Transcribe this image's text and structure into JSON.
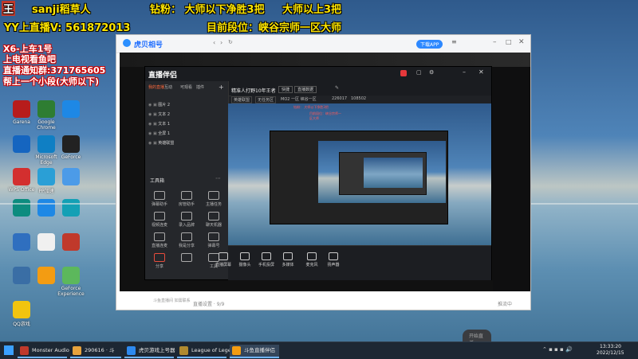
{
  "overlay": {
    "top_name": "sanji稻草人",
    "top_rank1": "钻粉： 大师以下净胜3把",
    "top_rank2": "大师以上3把",
    "yy_line": "YY上直播V:  561872013",
    "current_rank": "目前段位：峡谷宗师一区大师",
    "promo1": "X6-上车1号",
    "promo2": "上电视看鱼吧",
    "promo3": "直播通知群:371765605",
    "promo4": "帮上一个小段(大师以下)"
  },
  "desktop_icons": [
    {
      "label": "Garena",
      "color": "#b71c1c"
    },
    {
      "label": "Google Chrome",
      "color": "#2e7d32"
    },
    {
      "label": "",
      "color": "#1e88e5"
    },
    {
      "label": "",
      "color": "#1565c0"
    },
    {
      "label": "Microsoft Edge",
      "color": "#0f7fc4"
    },
    {
      "label": "GeForce",
      "color": "#222222"
    },
    {
      "label": "WPS Office",
      "color": "#d32f2f"
    },
    {
      "label": "PP加速",
      "color": "#2a9fd6"
    },
    {
      "label": "",
      "color": "#4c9be8"
    },
    {
      "label": "",
      "color": "#0d8c7f"
    },
    {
      "label": "",
      "color": "#1e88e5"
    },
    {
      "label": "",
      "color": "#14a0b5"
    },
    {
      "label": "",
      "color": "#2f6fbf"
    },
    {
      "label": "",
      "color": "#f0f0f0"
    },
    {
      "label": "",
      "color": "#c0392b"
    },
    {
      "label": "",
      "color": "#3a6ea5"
    },
    {
      "label": "",
      "color": "#f39c12"
    },
    {
      "label": "GeForce Experience",
      "color": "#5cb85c"
    },
    {
      "label": "QQ游戏",
      "color": "#f1c40f"
    }
  ],
  "app": {
    "logo": "虎贝相号",
    "download_btn": "下载APP",
    "tabs": [
      "我的直播",
      "互动",
      "可观看",
      "插件"
    ],
    "layers": [
      "图片 2",
      "文本 2",
      "文本 1",
      "全屏 1",
      "英雄联盟"
    ],
    "room_title": "精准人打野10年王者",
    "room_tag": "快捷",
    "room_status": "直播数据",
    "room_category": "英雄联盟",
    "room_sub": "无任务区",
    "room_id": "MO2  一区 峡谷一区",
    "room_fans": "226017",
    "room_follow": "108502",
    "brand": "直播伴侣",
    "tools_title": "工具箱",
    "tools": [
      "弹幕助手",
      "房管助手",
      "主播任务",
      "视频连麦",
      "录入品牌",
      "聊天机器",
      "直播连麦",
      "我是分享",
      "弹幕号",
      "分享",
      "",
      "工具"
    ],
    "bottom_btns": [
      "直播屏幕",
      "摄像头",
      "手机投屏",
      "多媒体",
      "麦克风",
      "扬声器"
    ],
    "start_btn": "开始直播",
    "notice": "斗鱼直播间 如需联系",
    "footer_left": "直播设置 · 9/9",
    "footer_right": "推流中"
  },
  "taskbar": {
    "items": [
      {
        "label": "Monster Audio",
        "color": "#c0392b"
      },
      {
        "label": "290616 · 斗",
        "color": "#e8a33d"
      },
      {
        "label": "虎贝游戏上号器",
        "color": "#2d89ef"
      },
      {
        "label": "League of Legends",
        "color": "#b08a2f"
      },
      {
        "label": "斗鱼直播伴侣",
        "color": "#f39c12"
      }
    ],
    "time": "13:33:20",
    "date": "2022/12/15"
  }
}
